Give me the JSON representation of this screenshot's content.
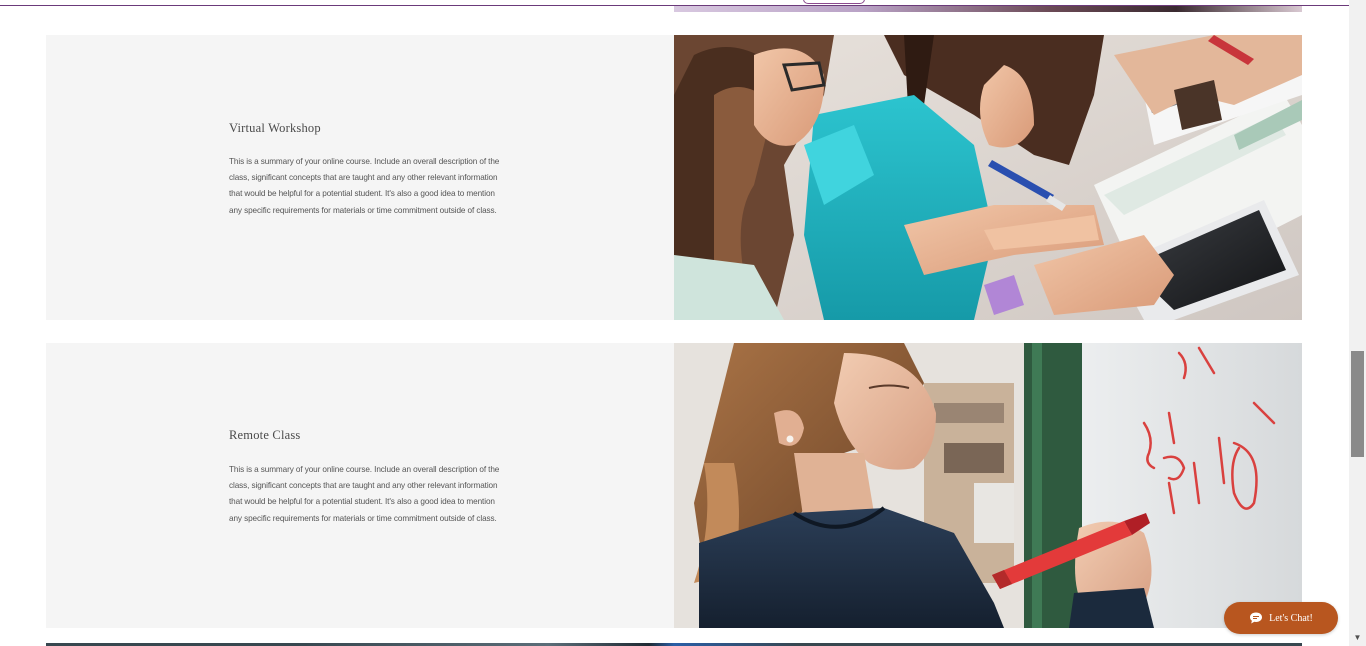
{
  "courses": [
    {
      "title": "Virtual Workshop",
      "description": "This is a summary of your online course. Include an overall description of the class, significant concepts that are taught and any other relevant information that would be helpful for a potential student. It's also a good idea to mention any specific requirements for materials or time commitment outside of class."
    },
    {
      "title": "Remote Class",
      "description": "This is a summary of your online course. Include an overall description of the class, significant concepts that are taught and any other relevant information that would be helpful for a potential student. It's also a good idea to mention any specific requirements for materials or time commitment outside of class."
    }
  ],
  "chat": {
    "label": "Let's Chat!",
    "icon": "chat-bubble-icon"
  },
  "colors": {
    "card_background": "#f5f5f5",
    "chat_button": "#b8561f",
    "header_accent": "#6b3a7a"
  }
}
